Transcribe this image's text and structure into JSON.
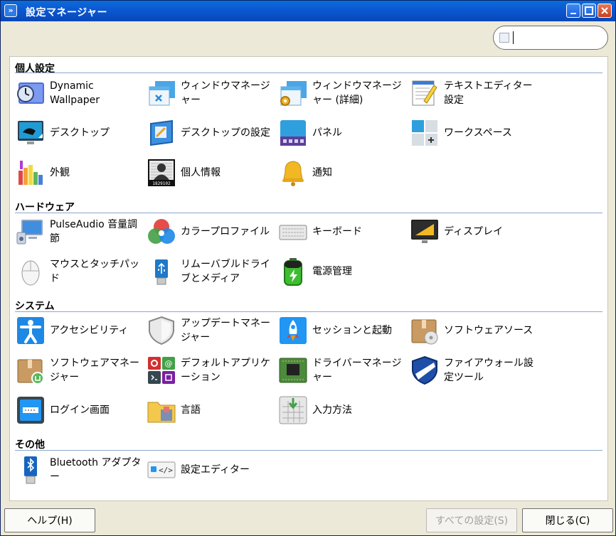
{
  "window": {
    "title": "設定マネージャー"
  },
  "search": {
    "value": "",
    "placeholder": ""
  },
  "categories": [
    {
      "label": "個人設定",
      "items": [
        {
          "label": "Dynamic Wallpaper",
          "icon": "clock-wallpaper-icon"
        },
        {
          "label": "ウィンドウマネージャー",
          "icon": "window-manager-icon"
        },
        {
          "label": "ウィンドウマネージャー (詳細)",
          "icon": "window-manager-tweaks-icon"
        },
        {
          "label": "テキストエディター設定",
          "icon": "text-editor-icon"
        },
        {
          "label": "デスクトップ",
          "icon": "desktop-icon"
        },
        {
          "label": "デスクトップの設定",
          "icon": "desktop-settings-icon"
        },
        {
          "label": "パネル",
          "icon": "panel-icon"
        },
        {
          "label": "ワークスペース",
          "icon": "workspaces-icon"
        },
        {
          "label": "外観",
          "icon": "appearance-palette-icon"
        },
        {
          "label": "個人情報",
          "icon": "personal-info-icon"
        },
        {
          "label": "通知",
          "icon": "notification-bell-icon"
        }
      ]
    },
    {
      "label": "ハードウェア",
      "items": [
        {
          "label": "PulseAudio 音量調節",
          "icon": "audio-computer-icon"
        },
        {
          "label": "カラープロファイル",
          "icon": "color-profile-icon"
        },
        {
          "label": "キーボード",
          "icon": "keyboard-icon"
        },
        {
          "label": "ディスプレイ",
          "icon": "display-icon"
        },
        {
          "label": "マウスとタッチパッド",
          "icon": "mouse-icon"
        },
        {
          "label": "リムーバブルドライブとメディア",
          "icon": "usb-drive-icon"
        },
        {
          "label": "電源管理",
          "icon": "battery-icon"
        }
      ]
    },
    {
      "label": "システム",
      "items": [
        {
          "label": "アクセシビリティ",
          "icon": "accessibility-icon"
        },
        {
          "label": "アップデートマネージャー",
          "icon": "update-shield-icon"
        },
        {
          "label": "セッションと起動",
          "icon": "rocket-icon"
        },
        {
          "label": "ソフトウェアソース",
          "icon": "software-sources-icon"
        },
        {
          "label": "ソフトウェアマネージャー",
          "icon": "software-manager-icon"
        },
        {
          "label": "デフォルトアプリケーション",
          "icon": "default-apps-icon"
        },
        {
          "label": "ドライバーマネージャー",
          "icon": "driver-board-icon"
        },
        {
          "label": "ファイアウォール設定ツール",
          "icon": "firewall-shield-icon"
        },
        {
          "label": "ログイン画面",
          "icon": "login-screen-icon"
        },
        {
          "label": "言語",
          "icon": "language-folder-icon"
        },
        {
          "label": "入力方法",
          "icon": "input-method-icon"
        }
      ]
    },
    {
      "label": "その他",
      "items": [
        {
          "label": "Bluetooth アダプター",
          "icon": "bluetooth-adapter-icon"
        },
        {
          "label": "設定エディター",
          "icon": "settings-editor-icon"
        }
      ]
    }
  ],
  "footer": {
    "help_label": "ヘルプ(H)",
    "all_settings_label": "すべての設定(S)",
    "close_label": "閉じる(C)"
  },
  "colors": {
    "titlebar": "#0c59d3",
    "category_rule": "#8ea7cc"
  }
}
